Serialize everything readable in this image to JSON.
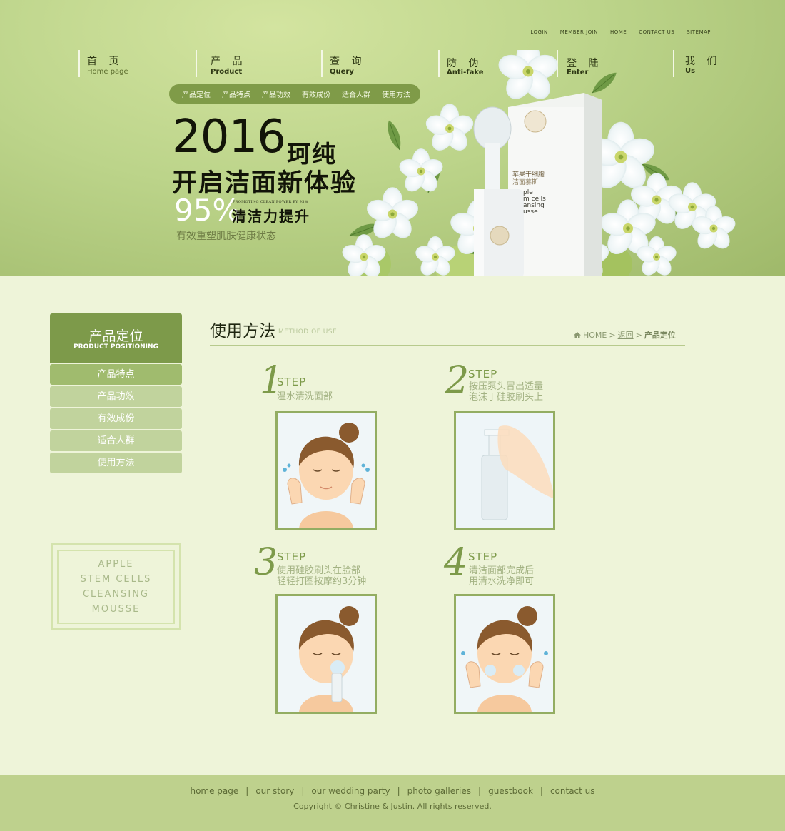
{
  "top_links": [
    "LOGIN",
    "MEMBER JOIN",
    "HOME",
    "CONTACT US",
    "SITEMAP"
  ],
  "nav": [
    {
      "cn": "首 页",
      "en": "Home page"
    },
    {
      "cn": "产 品",
      "en": "Product"
    },
    {
      "cn": "查 询",
      "en": "Query"
    },
    {
      "cn": "防 伪",
      "en": "Anti-fake"
    },
    {
      "cn": "登 陆",
      "en": "Enter"
    },
    {
      "cn": "我 们",
      "en": "Us"
    }
  ],
  "subnav": [
    "产品定位",
    "产品特点",
    "产品功效",
    "有效成份",
    "适合人群",
    "使用方法"
  ],
  "hero": {
    "year": "2016",
    "brand": "珂纯",
    "line2": "开启洁面新体验",
    "percent": "95%",
    "small_en": "PROMOTING CLEAN POWER BY 95%",
    "clean": "清洁力提升",
    "sub": "有效重塑肌肤健康状态"
  },
  "product_box": {
    "label_cn": "苹果干细胞",
    "label_cn2": "洁面慕斯",
    "label_en": "ple\nm cells\nansing\nusse"
  },
  "sidebar": {
    "head_cn": "产品定位",
    "head_en": "PRODUCT POSITIONING",
    "items": [
      "产品特点",
      "产品功效",
      "有效成份",
      "适合人群",
      "使用方法"
    ],
    "active_index": 0
  },
  "side_logo": [
    "APPLE",
    "STEM CELLS",
    "CLEANSING",
    "MOUSSE"
  ],
  "content": {
    "title": "使用方法",
    "title_en": "METHOD OF USE",
    "breadcrumb": {
      "home": "HOME",
      "sep1": ">",
      "back": "返回",
      "sep2": ">",
      "current": "产品定位"
    }
  },
  "steps": [
    {
      "num": "1",
      "word": "STEP",
      "desc": [
        "温水清洗面部"
      ]
    },
    {
      "num": "2",
      "word": "STEP",
      "desc": [
        "按压泵头冒出适量",
        "泡沫于硅胶刷头上"
      ]
    },
    {
      "num": "3",
      "word": "STEP",
      "desc": [
        "使用硅胶刷头在脸部",
        "轻轻打圈按摩约3分钟"
      ]
    },
    {
      "num": "4",
      "word": "STEP",
      "desc": [
        "清洁面部完成后",
        "用清水洗净即可"
      ]
    }
  ],
  "footer": {
    "links": [
      "home page",
      "our story",
      "our wedding party",
      "photo galleries",
      "guestbook",
      "contact us"
    ],
    "separator": "|",
    "copyright": "Copyright © Christine & Justin. All rights reserved."
  },
  "colors": {
    "banner_green": "#bcd48a",
    "accent_green": "#7d9a4a",
    "page_bg": "#eef4d9",
    "footer_bg": "#bed18d"
  }
}
